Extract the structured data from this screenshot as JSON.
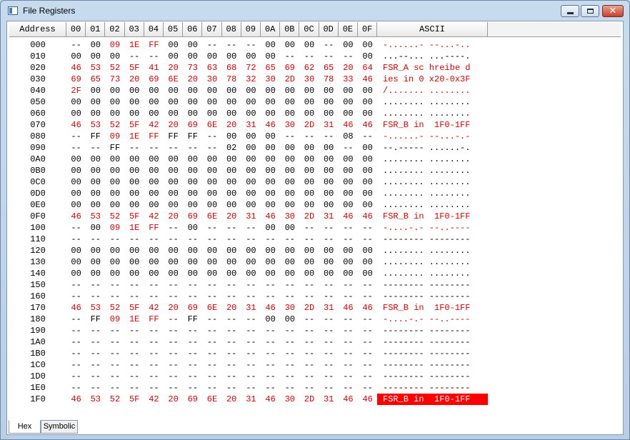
{
  "window": {
    "title": "File Registers"
  },
  "header": {
    "address": "Address",
    "columns": [
      "00",
      "01",
      "02",
      "03",
      "04",
      "05",
      "06",
      "07",
      "08",
      "09",
      "0A",
      "0B",
      "0C",
      "0D",
      "0E",
      "0F"
    ],
    "ascii": "ASCII"
  },
  "rows": [
    {
      "addr": "000",
      "red": true,
      "bytes": [
        "--",
        "00",
        "09",
        "1E",
        "FF",
        "00",
        "00",
        "--",
        "--",
        "--",
        "00",
        "00",
        "00",
        "--",
        "00",
        "00"
      ],
      "redmask": [
        0,
        0,
        1,
        1,
        1,
        0,
        0,
        0,
        0,
        0,
        0,
        0,
        0,
        0,
        0,
        0
      ],
      "ascii": "-......- --...-.."
    },
    {
      "addr": "010",
      "red": false,
      "bytes": [
        "00",
        "00",
        "00",
        "--",
        "--",
        "00",
        "00",
        "00",
        "00",
        "00",
        "00",
        "--",
        "--",
        "--",
        "--",
        "00"
      ],
      "ascii": "...--... ...----."
    },
    {
      "addr": "020",
      "red": true,
      "bytes": [
        "46",
        "53",
        "52",
        "5F",
        "41",
        "20",
        "73",
        "63",
        "68",
        "72",
        "65",
        "69",
        "62",
        "65",
        "20",
        "64"
      ],
      "ascii": "FSR_A sc hreibe d"
    },
    {
      "addr": "030",
      "red": true,
      "bytes": [
        "69",
        "65",
        "73",
        "20",
        "69",
        "6E",
        "20",
        "30",
        "78",
        "32",
        "30",
        "2D",
        "30",
        "78",
        "33",
        "46"
      ],
      "ascii": "ies in 0 x20-0x3F"
    },
    {
      "addr": "040",
      "red": true,
      "bytes": [
        "2F",
        "00",
        "00",
        "00",
        "00",
        "00",
        "00",
        "00",
        "00",
        "00",
        "00",
        "00",
        "00",
        "00",
        "00",
        "00"
      ],
      "redmask": [
        1,
        0,
        0,
        0,
        0,
        0,
        0,
        0,
        0,
        0,
        0,
        0,
        0,
        0,
        0,
        0
      ],
      "ascii": "/....... ........"
    },
    {
      "addr": "050",
      "red": false,
      "bytes": [
        "00",
        "00",
        "00",
        "00",
        "00",
        "00",
        "00",
        "00",
        "00",
        "00",
        "00",
        "00",
        "00",
        "00",
        "00",
        "00"
      ],
      "ascii": "........ ........"
    },
    {
      "addr": "060",
      "red": false,
      "bytes": [
        "00",
        "00",
        "00",
        "00",
        "00",
        "00",
        "00",
        "00",
        "00",
        "00",
        "00",
        "00",
        "00",
        "00",
        "00",
        "00"
      ],
      "ascii": "........ ........"
    },
    {
      "addr": "070",
      "red": true,
      "bytes": [
        "46",
        "53",
        "52",
        "5F",
        "42",
        "20",
        "69",
        "6E",
        "20",
        "31",
        "46",
        "30",
        "2D",
        "31",
        "46",
        "46"
      ],
      "ascii": "FSR_B in  1F0-1FF"
    },
    {
      "addr": "080",
      "red": true,
      "bytes": [
        "--",
        "FF",
        "09",
        "1E",
        "FF",
        "FF",
        "FF",
        "--",
        "00",
        "00",
        "00",
        "--",
        "--",
        "--",
        "08",
        "--"
      ],
      "redmask": [
        0,
        0,
        1,
        1,
        1,
        0,
        0,
        0,
        0,
        0,
        0,
        0,
        0,
        0,
        0,
        0
      ],
      "ascii": "-......- --...-.-"
    },
    {
      "addr": "090",
      "red": false,
      "bytes": [
        "--",
        "--",
        "FF",
        "--",
        "--",
        "--",
        "--",
        "--",
        "02",
        "00",
        "00",
        "00",
        "00",
        "00",
        "--",
        "00"
      ],
      "ascii": "--.----- ......-."
    },
    {
      "addr": "0A0",
      "red": false,
      "bytes": [
        "00",
        "00",
        "00",
        "00",
        "00",
        "00",
        "00",
        "00",
        "00",
        "00",
        "00",
        "00",
        "00",
        "00",
        "00",
        "00"
      ],
      "ascii": "........ ........"
    },
    {
      "addr": "0B0",
      "red": false,
      "bytes": [
        "00",
        "00",
        "00",
        "00",
        "00",
        "00",
        "00",
        "00",
        "00",
        "00",
        "00",
        "00",
        "00",
        "00",
        "00",
        "00"
      ],
      "ascii": "........ ........"
    },
    {
      "addr": "0C0",
      "red": false,
      "bytes": [
        "00",
        "00",
        "00",
        "00",
        "00",
        "00",
        "00",
        "00",
        "00",
        "00",
        "00",
        "00",
        "00",
        "00",
        "00",
        "00"
      ],
      "ascii": "........ ........"
    },
    {
      "addr": "0D0",
      "red": false,
      "bytes": [
        "00",
        "00",
        "00",
        "00",
        "00",
        "00",
        "00",
        "00",
        "00",
        "00",
        "00",
        "00",
        "00",
        "00",
        "00",
        "00"
      ],
      "ascii": "........ ........"
    },
    {
      "addr": "0E0",
      "red": false,
      "bytes": [
        "00",
        "00",
        "00",
        "00",
        "00",
        "00",
        "00",
        "00",
        "00",
        "00",
        "00",
        "00",
        "00",
        "00",
        "00",
        "00"
      ],
      "ascii": "........ ........"
    },
    {
      "addr": "0F0",
      "red": true,
      "bytes": [
        "46",
        "53",
        "52",
        "5F",
        "42",
        "20",
        "69",
        "6E",
        "20",
        "31",
        "46",
        "30",
        "2D",
        "31",
        "46",
        "46"
      ],
      "ascii": "FSR_B in  1F0-1FF"
    },
    {
      "addr": "100",
      "red": true,
      "bytes": [
        "--",
        "00",
        "09",
        "1E",
        "FF",
        "--",
        "00",
        "--",
        "--",
        "--",
        "00",
        "00",
        "--",
        "--",
        "--",
        "--"
      ],
      "redmask": [
        0,
        0,
        1,
        1,
        1,
        0,
        0,
        0,
        0,
        0,
        0,
        0,
        0,
        0,
        0,
        0
      ],
      "ascii": "-....-.- --..----"
    },
    {
      "addr": "110",
      "red": false,
      "bytes": [
        "--",
        "--",
        "--",
        "--",
        "--",
        "--",
        "--",
        "--",
        "--",
        "--",
        "--",
        "--",
        "--",
        "--",
        "--",
        "--"
      ],
      "ascii": "-------- --------"
    },
    {
      "addr": "120",
      "red": false,
      "bytes": [
        "00",
        "00",
        "00",
        "00",
        "00",
        "00",
        "00",
        "00",
        "00",
        "00",
        "00",
        "00",
        "00",
        "00",
        "00",
        "00"
      ],
      "ascii": "........ ........"
    },
    {
      "addr": "130",
      "red": false,
      "bytes": [
        "00",
        "00",
        "00",
        "00",
        "00",
        "00",
        "00",
        "00",
        "00",
        "00",
        "00",
        "00",
        "00",
        "00",
        "00",
        "00"
      ],
      "ascii": "........ ........"
    },
    {
      "addr": "140",
      "red": false,
      "bytes": [
        "00",
        "00",
        "00",
        "00",
        "00",
        "00",
        "00",
        "00",
        "00",
        "00",
        "00",
        "00",
        "00",
        "00",
        "00",
        "00"
      ],
      "ascii": "........ ........"
    },
    {
      "addr": "150",
      "red": false,
      "bytes": [
        "--",
        "--",
        "--",
        "--",
        "--",
        "--",
        "--",
        "--",
        "--",
        "--",
        "--",
        "--",
        "--",
        "--",
        "--",
        "--"
      ],
      "ascii": "-------- --------"
    },
    {
      "addr": "160",
      "red": false,
      "bytes": [
        "--",
        "--",
        "--",
        "--",
        "--",
        "--",
        "--",
        "--",
        "--",
        "--",
        "--",
        "--",
        "--",
        "--",
        "--",
        "--"
      ],
      "ascii": "-------- --------"
    },
    {
      "addr": "170",
      "red": true,
      "bytes": [
        "46",
        "53",
        "52",
        "5F",
        "42",
        "20",
        "69",
        "6E",
        "20",
        "31",
        "46",
        "30",
        "2D",
        "31",
        "46",
        "46"
      ],
      "ascii": "FSR_B in  1F0-1FF"
    },
    {
      "addr": "180",
      "red": true,
      "bytes": [
        "--",
        "FF",
        "09",
        "1E",
        "FF",
        "--",
        "FF",
        "--",
        "--",
        "--",
        "00",
        "00",
        "--",
        "--",
        "--",
        "--"
      ],
      "redmask": [
        0,
        0,
        1,
        1,
        1,
        0,
        0,
        0,
        0,
        0,
        0,
        0,
        0,
        0,
        0,
        0
      ],
      "ascii": "-....-.- --..----"
    },
    {
      "addr": "190",
      "red": false,
      "bytes": [
        "--",
        "--",
        "--",
        "--",
        "--",
        "--",
        "--",
        "--",
        "--",
        "--",
        "--",
        "--",
        "--",
        "--",
        "--",
        "--"
      ],
      "ascii": "-------- --------"
    },
    {
      "addr": "1A0",
      "red": false,
      "bytes": [
        "--",
        "--",
        "--",
        "--",
        "--",
        "--",
        "--",
        "--",
        "--",
        "--",
        "--",
        "--",
        "--",
        "--",
        "--",
        "--"
      ],
      "ascii": "-------- --------"
    },
    {
      "addr": "1B0",
      "red": false,
      "bytes": [
        "--",
        "--",
        "--",
        "--",
        "--",
        "--",
        "--",
        "--",
        "--",
        "--",
        "--",
        "--",
        "--",
        "--",
        "--",
        "--"
      ],
      "ascii": "-------- --------"
    },
    {
      "addr": "1C0",
      "red": false,
      "bytes": [
        "--",
        "--",
        "--",
        "--",
        "--",
        "--",
        "--",
        "--",
        "--",
        "--",
        "--",
        "--",
        "--",
        "--",
        "--",
        "--"
      ],
      "ascii": "-------- --------"
    },
    {
      "addr": "1D0",
      "red": false,
      "bytes": [
        "--",
        "--",
        "--",
        "--",
        "--",
        "--",
        "--",
        "--",
        "--",
        "--",
        "--",
        "--",
        "--",
        "--",
        "--",
        "--"
      ],
      "ascii": "-------- --------"
    },
    {
      "addr": "1E0",
      "red": false,
      "bytes": [
        "--",
        "--",
        "--",
        "--",
        "--",
        "--",
        "--",
        "--",
        "--",
        "--",
        "--",
        "--",
        "--",
        "--",
        "--",
        "--"
      ],
      "ascii": "-------- --------"
    },
    {
      "addr": "1F0",
      "red": true,
      "selected": true,
      "bytes": [
        "46",
        "53",
        "52",
        "5F",
        "42",
        "20",
        "69",
        "6E",
        "20",
        "31",
        "46",
        "30",
        "2D",
        "31",
        "46",
        "46"
      ],
      "ascii": "FSR_B in  1F0-1FF"
    }
  ],
  "tabs": [
    "Hex",
    "Symbolic"
  ],
  "colors": {
    "changed": "#e00000",
    "selection": "#ff0000"
  }
}
